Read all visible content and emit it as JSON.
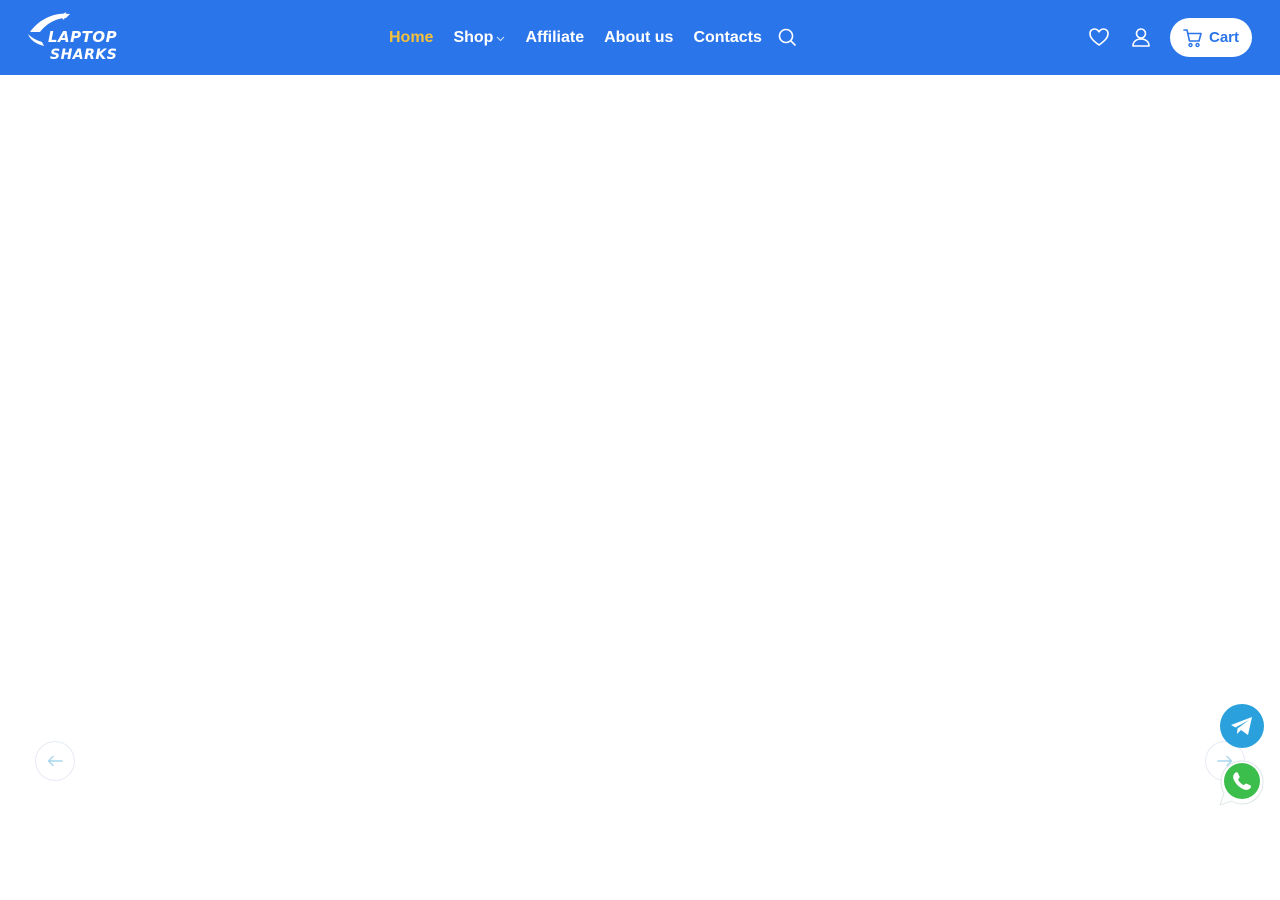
{
  "header": {
    "brand": {
      "line1": "LAPTOP",
      "line2": "SHARKS"
    },
    "nav": [
      {
        "label": "Home",
        "active": true
      },
      {
        "label": "Shop",
        "has_dropdown": true
      },
      {
        "label": "Affiliate"
      },
      {
        "label": "About us"
      },
      {
        "label": "Contacts"
      }
    ],
    "icons": {
      "search": "search-icon",
      "wishlist": "heart-icon",
      "account": "user-icon",
      "cart": "cart-icon"
    },
    "cart_label": "Cart"
  },
  "slider": {
    "prev": "arrow-left-icon",
    "next": "arrow-right-icon"
  },
  "floating": {
    "telegram": "telegram-icon",
    "whatsapp": "whatsapp-icon"
  },
  "colors": {
    "primary": "#2b75ea",
    "active_nav": "#f5c13b",
    "telegram": "#2aa1dc",
    "whatsapp": "#3cbe4d"
  }
}
